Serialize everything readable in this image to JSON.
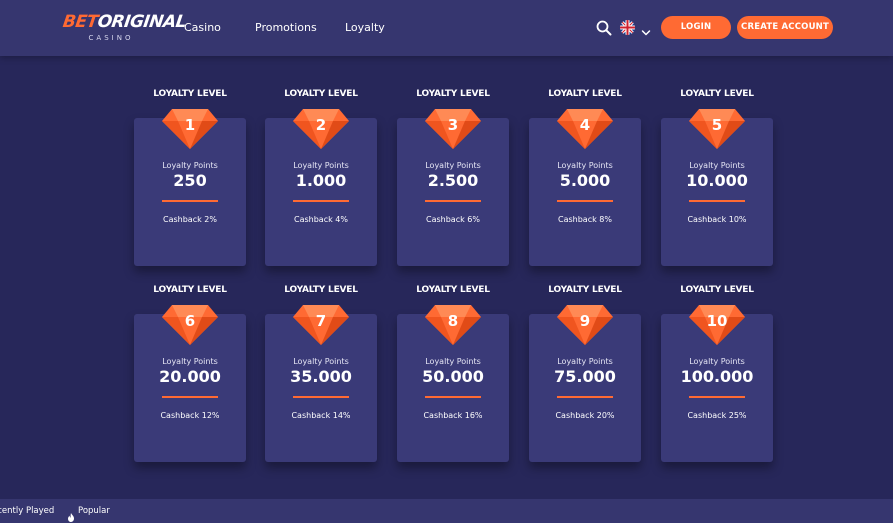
{
  "header": {
    "logo_part1": "BET",
    "logo_part2": "ORIGINAL",
    "logo_sub": "CASINO",
    "nav": [
      "Casino",
      "Promotions",
      "Loyalty"
    ],
    "login_label": "LOGIN",
    "create_label": "CREATE ACCOUNT"
  },
  "levels": [
    {
      "title": "LOYALTY LEVEL",
      "num": "1",
      "points_label": "Loyalty Points",
      "points": "250",
      "cashback": "Cashback 2%"
    },
    {
      "title": "LOYALTY LEVEL",
      "num": "2",
      "points_label": "Loyalty Points",
      "points": "1.000",
      "cashback": "Cashback 4%"
    },
    {
      "title": "LOYALTY LEVEL",
      "num": "3",
      "points_label": "Loyalty Points",
      "points": "2.500",
      "cashback": "Cashback 6%"
    },
    {
      "title": "LOYALTY LEVEL",
      "num": "4",
      "points_label": "Loyalty Points",
      "points": "5.000",
      "cashback": "Cashback 8%"
    },
    {
      "title": "LOYALTY LEVEL",
      "num": "5",
      "points_label": "Loyalty Points",
      "points": "10.000",
      "cashback": "Cashback 10%"
    },
    {
      "title": "LOYALTY LEVEL",
      "num": "6",
      "points_label": "Loyalty Points",
      "points": "20.000",
      "cashback": "Cashback 12%"
    },
    {
      "title": "LOYALTY LEVEL",
      "num": "7",
      "points_label": "Loyalty Points",
      "points": "35.000",
      "cashback": "Cashback 14%"
    },
    {
      "title": "LOYALTY LEVEL",
      "num": "8",
      "points_label": "Loyalty Points",
      "points": "50.000",
      "cashback": "Cashback 16%"
    },
    {
      "title": "LOYALTY LEVEL",
      "num": "9",
      "points_label": "Loyalty Points",
      "points": "75.000",
      "cashback": "Cashback 20%"
    },
    {
      "title": "LOYALTY LEVEL",
      "num": "10",
      "points_label": "Loyalty Points",
      "points": "100.000",
      "cashback": "Cashback 25%"
    }
  ],
  "footer": {
    "recent": "ecently Played",
    "popular": "Popular"
  },
  "icons": {
    "search": "search-icon",
    "language": "uk-flag-icon",
    "language_toggle": "chevron-down-icon",
    "level_badge": "gem-icon",
    "popular": "flame-icon"
  },
  "colors": {
    "accent": "#ff6a33",
    "background": "#27275a",
    "header": "#36366f",
    "card": "#3a3a78"
  }
}
